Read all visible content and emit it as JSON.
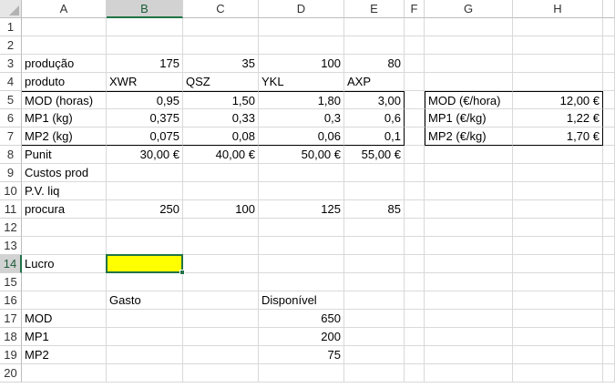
{
  "columns": [
    "A",
    "B",
    "C",
    "D",
    "E",
    "F",
    "G",
    "H"
  ],
  "selected_cell": "B14",
  "highlight_color": "#ffff00",
  "accent_color": "#217346",
  "rows": [
    {
      "n": "1",
      "cells": {}
    },
    {
      "n": "2",
      "cells": {}
    },
    {
      "n": "3",
      "cells": {
        "A": "produção",
        "B": "175",
        "C": "35",
        "D": "100",
        "E": "80"
      }
    },
    {
      "n": "4",
      "cells": {
        "A": "produto",
        "B": "XWR",
        "C": "QSZ",
        "D": "YKL",
        "E": "AXP"
      }
    },
    {
      "n": "5",
      "cells": {
        "A": "MOD (horas)",
        "B": "0,95",
        "C": "1,50",
        "D": "1,80",
        "E": "3,00",
        "G": "MOD (€/hora)",
        "H": "12,00 €"
      }
    },
    {
      "n": "6",
      "cells": {
        "A": "MP1 (kg)",
        "B": "0,375",
        "C": "0,33",
        "D": "0,3",
        "E": "0,6",
        "G": "MP1 (€/kg)",
        "H": "1,22 €"
      }
    },
    {
      "n": "7",
      "cells": {
        "A": "MP2 (kg)",
        "B": "0,075",
        "C": "0,08",
        "D": "0,06",
        "E": "0,1",
        "G": "MP2 (€/kg)",
        "H": "1,70 €"
      }
    },
    {
      "n": "8",
      "cells": {
        "A": "Punit",
        "B": "30,00 €",
        "C": "40,00 €",
        "D": "50,00 €",
        "E": "55,00 €"
      }
    },
    {
      "n": "9",
      "cells": {
        "A": "Custos prod"
      }
    },
    {
      "n": "10",
      "cells": {
        "A": "P.V. liq"
      }
    },
    {
      "n": "11",
      "cells": {
        "A": "procura",
        "B": "250",
        "C": "100",
        "D": "125",
        "E": "85"
      }
    },
    {
      "n": "12",
      "cells": {}
    },
    {
      "n": "13",
      "cells": {}
    },
    {
      "n": "14",
      "cells": {
        "A": "Lucro"
      }
    },
    {
      "n": "15",
      "cells": {}
    },
    {
      "n": "16",
      "cells": {
        "B": "Gasto",
        "D": "Disponível"
      }
    },
    {
      "n": "17",
      "cells": {
        "A": "MOD",
        "D": "650"
      }
    },
    {
      "n": "18",
      "cells": {
        "A": "MP1",
        "D": "200"
      }
    },
    {
      "n": "19",
      "cells": {
        "A": "MP2",
        "D": "75"
      }
    },
    {
      "n": "20",
      "cells": {}
    }
  ]
}
